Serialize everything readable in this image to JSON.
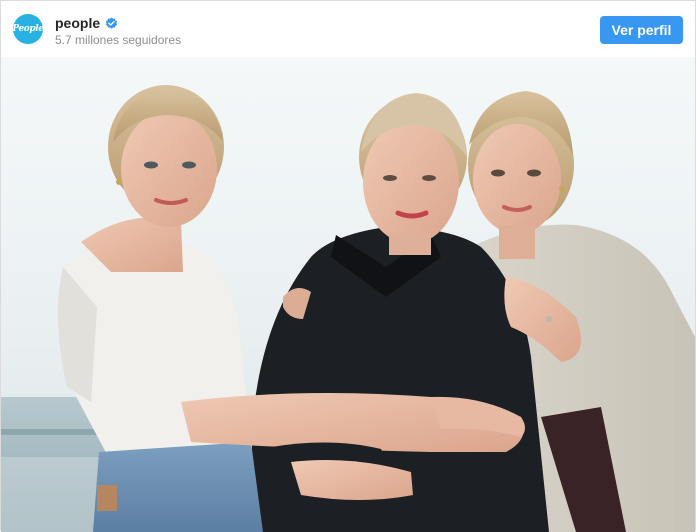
{
  "account": {
    "username": "people",
    "verified": true,
    "followers_text": "5.7 millones seguidores",
    "avatar_text": "People",
    "avatar_color": "#2ab1e4"
  },
  "actions": {
    "view_profile_label": "Ver perfil",
    "button_color": "#3897f0"
  },
  "post": {
    "media_type": "photo"
  }
}
